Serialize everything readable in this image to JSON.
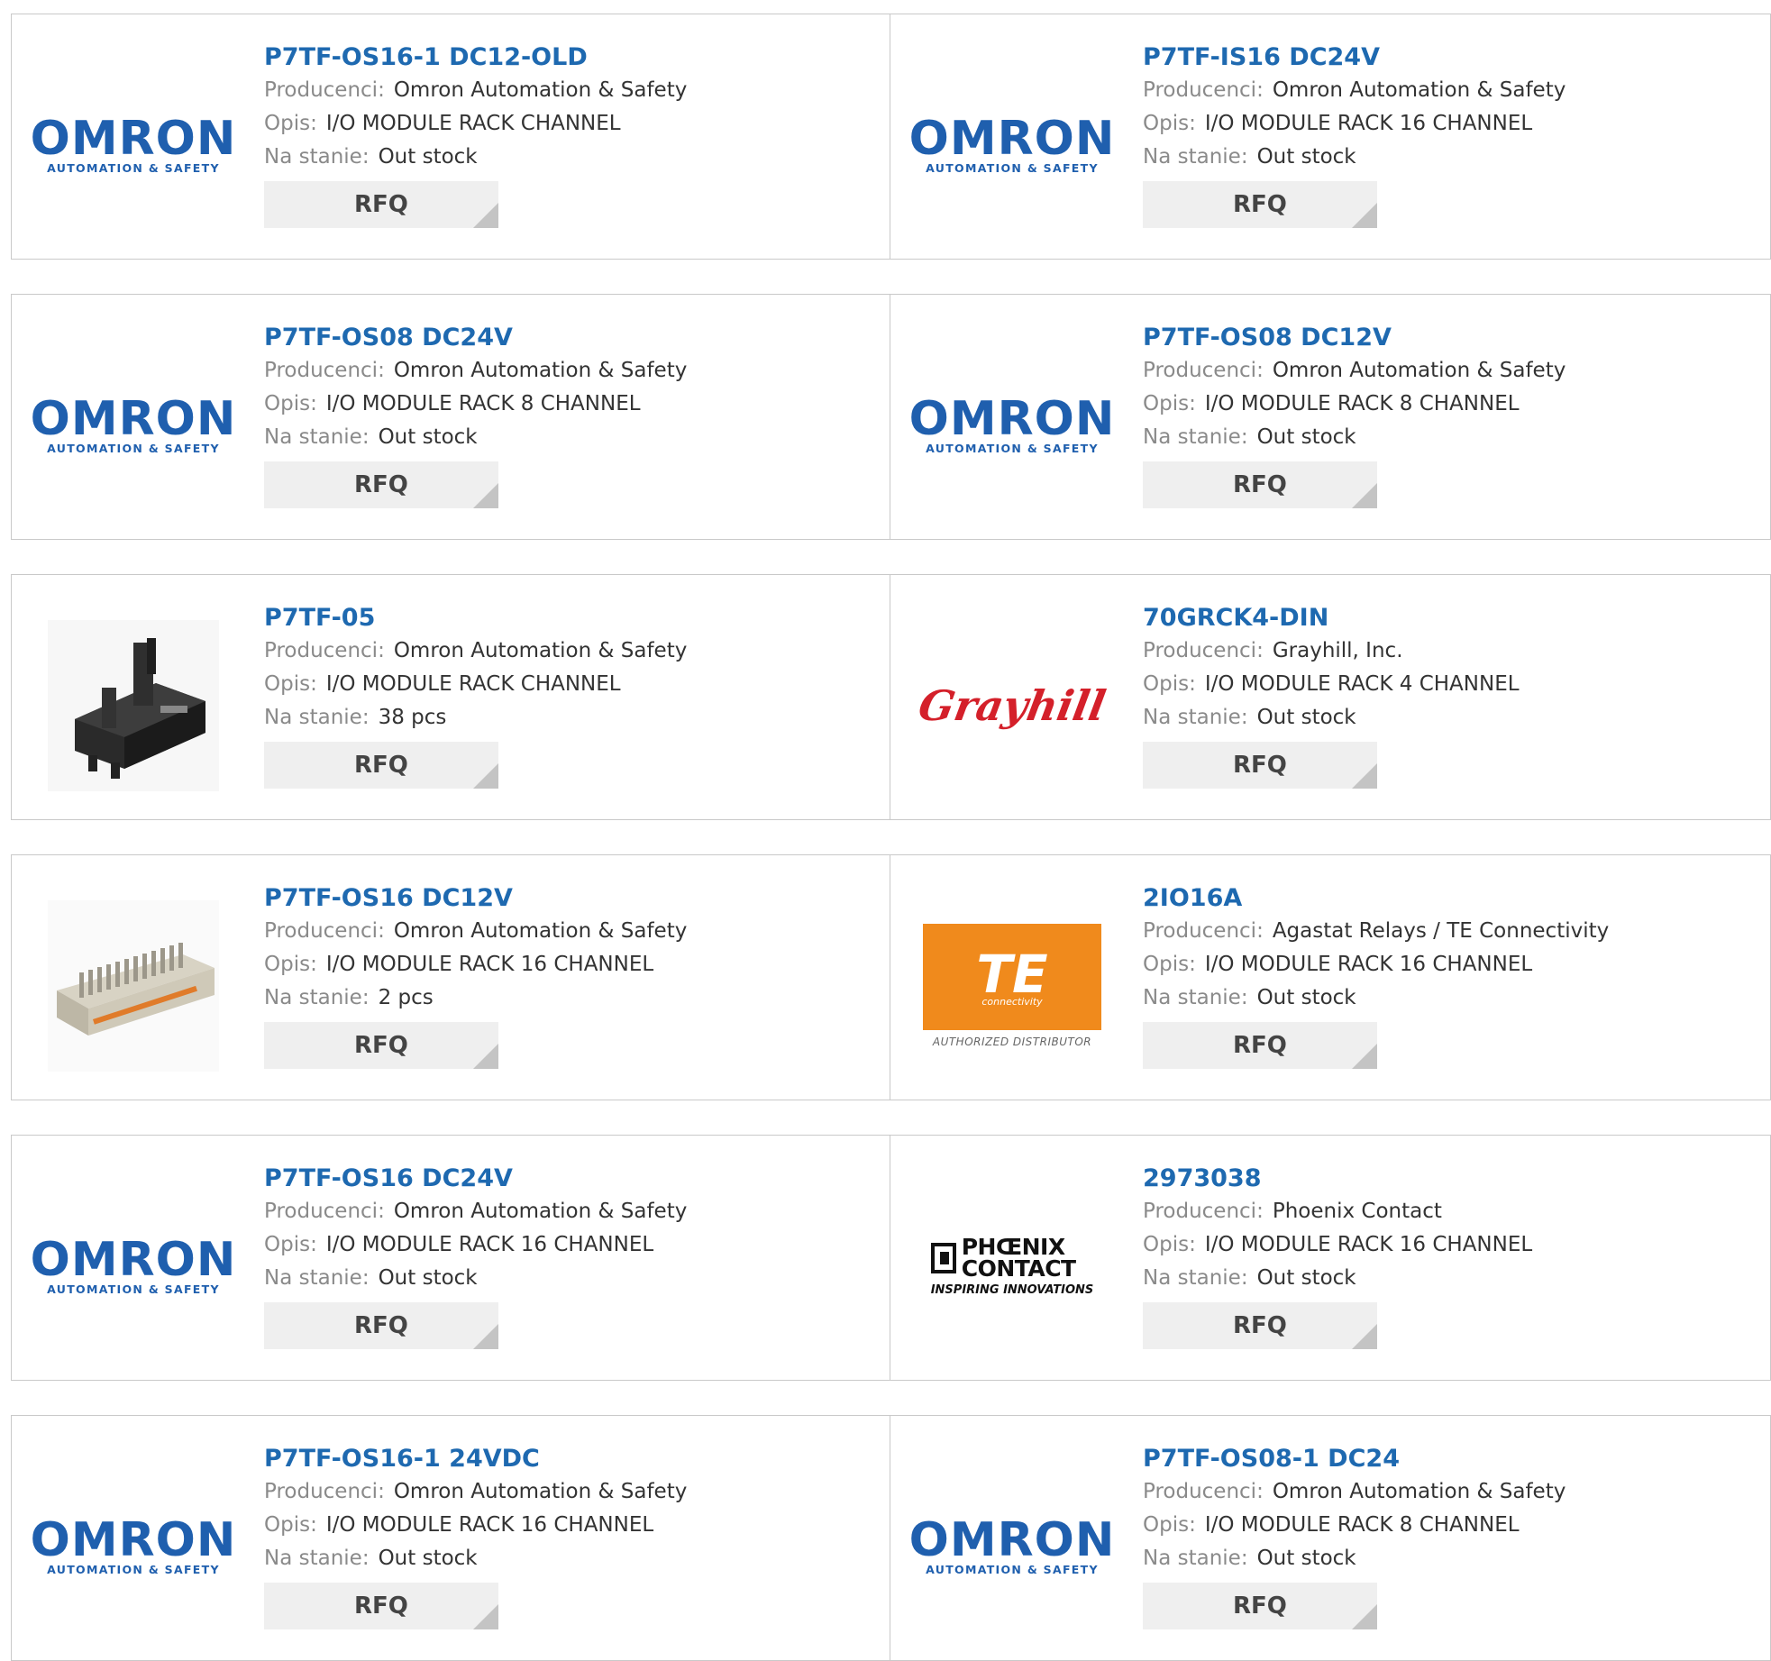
{
  "labels": {
    "manufacturer": "Producenci:",
    "description": "Opis:",
    "stock": "Na stanie:",
    "rfq": "RFQ"
  },
  "logos": {
    "omron": {
      "word": "OMRON",
      "tagline": "AUTOMATION & SAFETY"
    },
    "grayhill": {
      "word": "Grayhill"
    },
    "te": {
      "word": "TE",
      "sub": "connectivity",
      "caption": "AUTHORIZED DISTRIBUTOR"
    },
    "phoenix": {
      "line1": "PHŒNIX",
      "line2": "CONTACT",
      "caption": "INSPIRING INNOVATIONS"
    }
  },
  "colors": {
    "title": "#1e69b0",
    "omron": "#1f5fae",
    "grayhill": "#d4202a",
    "te": "#f08a1c"
  },
  "products": [
    {
      "part": "P7TF-OS16-1 DC12-OLD",
      "manufacturer": "Omron Automation & Safety",
      "description": "I/O MODULE RACK CHANNEL",
      "stock": "Out stock",
      "image": "omron-logo"
    },
    {
      "part": "P7TF-IS16 DC24V",
      "manufacturer": "Omron Automation & Safety",
      "description": "I/O MODULE RACK 16 CHANNEL",
      "stock": "Out stock",
      "image": "omron-logo"
    },
    {
      "part": "P7TF-OS08 DC24V",
      "manufacturer": "Omron Automation & Safety",
      "description": "I/O MODULE RACK 8 CHANNEL",
      "stock": "Out stock",
      "image": "omron-logo"
    },
    {
      "part": "P7TF-OS08 DC12V",
      "manufacturer": "Omron Automation & Safety",
      "description": "I/O MODULE RACK 8 CHANNEL",
      "stock": "Out stock",
      "image": "omron-logo"
    },
    {
      "part": "P7TF-05",
      "manufacturer": "Omron Automation & Safety",
      "description": "I/O MODULE RACK CHANNEL",
      "stock": "38 pcs",
      "image": "relay-socket-photo"
    },
    {
      "part": "70GRCK4-DIN",
      "manufacturer": "Grayhill, Inc.",
      "description": "I/O MODULE RACK 4 CHANNEL",
      "stock": "Out stock",
      "image": "grayhill-logo"
    },
    {
      "part": "P7TF-OS16 DC12V",
      "manufacturer": "Omron Automation & Safety",
      "description": "I/O MODULE RACK 16 CHANNEL",
      "stock": "2 pcs",
      "image": "io-rack-photo"
    },
    {
      "part": "2IO16A",
      "manufacturer": "Agastat Relays / TE Connectivity",
      "description": "I/O MODULE RACK 16 CHANNEL",
      "stock": "Out stock",
      "image": "te-logo"
    },
    {
      "part": "P7TF-OS16 DC24V",
      "manufacturer": "Omron Automation & Safety",
      "description": "I/O MODULE RACK 16 CHANNEL",
      "stock": "Out stock",
      "image": "omron-logo"
    },
    {
      "part": "2973038",
      "manufacturer": "Phoenix Contact",
      "description": "I/O MODULE RACK 16 CHANNEL",
      "stock": "Out stock",
      "image": "phoenix-logo"
    },
    {
      "part": "P7TF-OS16-1 24VDC",
      "manufacturer": "Omron Automation & Safety",
      "description": "I/O MODULE RACK 16 CHANNEL",
      "stock": "Out stock",
      "image": "omron-logo"
    },
    {
      "part": "P7TF-OS08-1 DC24",
      "manufacturer": "Omron Automation & Safety",
      "description": "I/O MODULE RACK 8 CHANNEL",
      "stock": "Out stock",
      "image": "omron-logo"
    }
  ]
}
